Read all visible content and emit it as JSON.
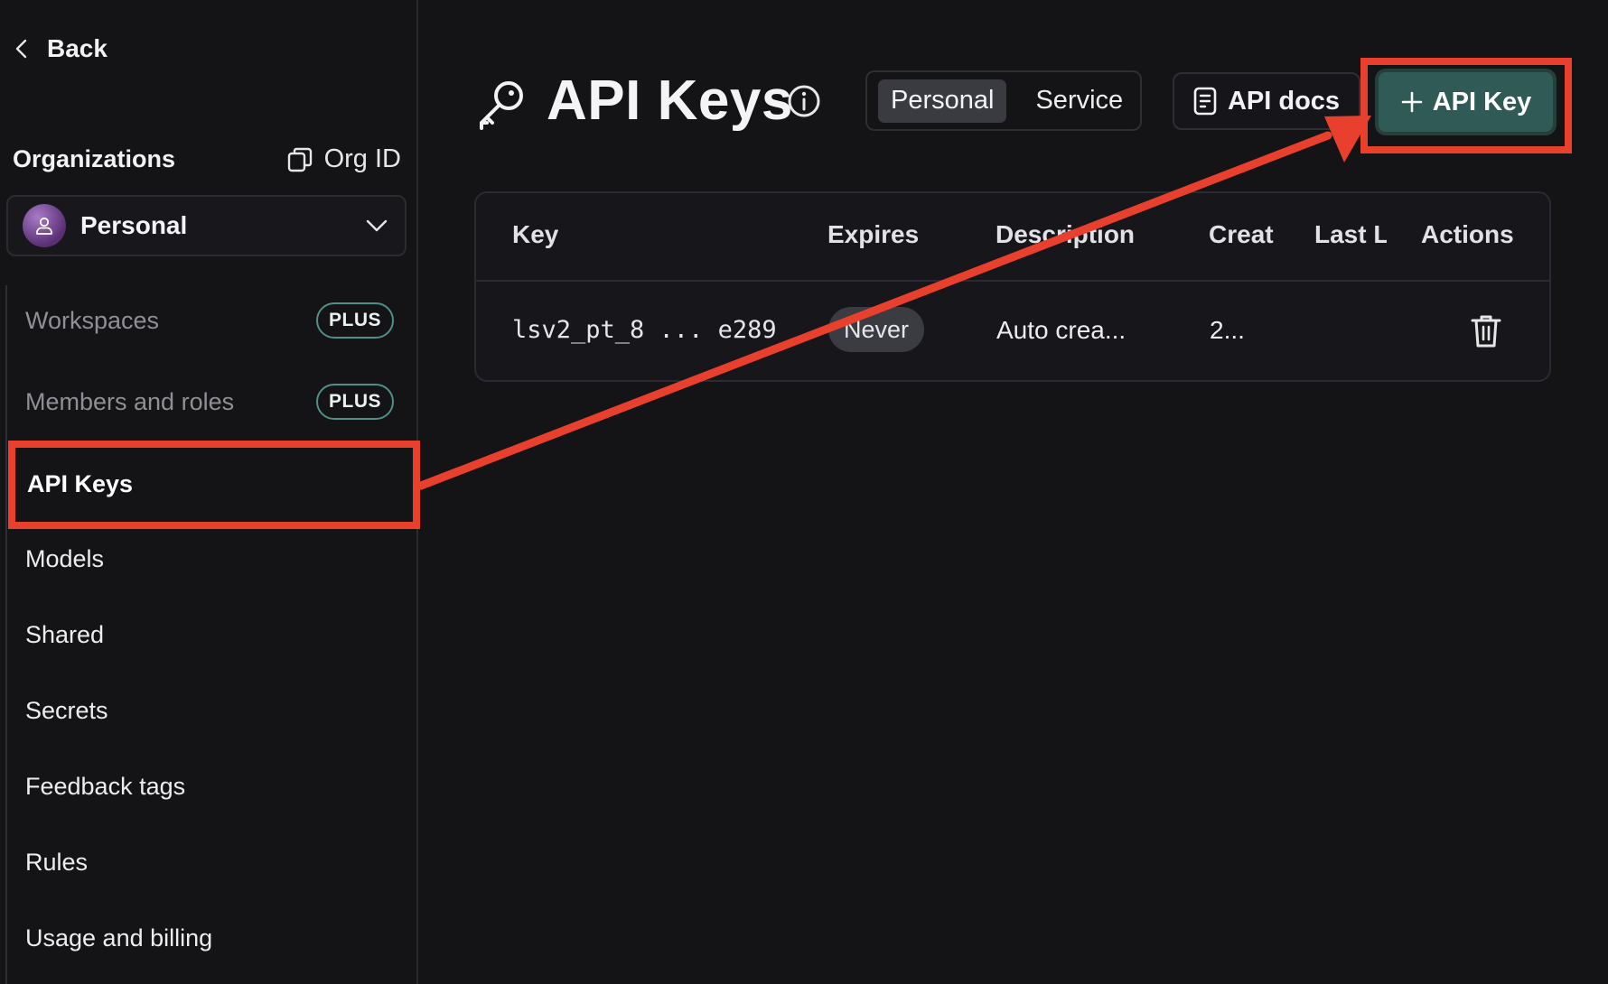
{
  "sidebar": {
    "back_label": "Back",
    "organizations_label": "Organizations",
    "org_id_label": "Org ID",
    "selected_org": "Personal",
    "nav": [
      {
        "label": "Workspaces",
        "badge": "PLUS",
        "muted": true,
        "active": false
      },
      {
        "label": "Members and roles",
        "badge": "PLUS",
        "muted": true,
        "active": false
      },
      {
        "label": "API Keys",
        "active": true
      },
      {
        "label": "Models"
      },
      {
        "label": "Shared"
      },
      {
        "label": "Secrets"
      },
      {
        "label": "Feedback tags"
      },
      {
        "label": "Rules"
      },
      {
        "label": "Usage and billing"
      }
    ]
  },
  "header": {
    "title": "API Keys",
    "tabs": [
      {
        "label": "Personal",
        "selected": true
      },
      {
        "label": "Service",
        "selected": false
      }
    ],
    "docs_button": "API docs",
    "add_button": "API Key"
  },
  "table": {
    "columns": [
      "Key",
      "Expires",
      "Description",
      "Creat",
      "Last L",
      "Actions"
    ],
    "rows": [
      {
        "key": "lsv2_pt_8 ... e289",
        "expires": "Never",
        "description": "Auto crea...",
        "created": "2...",
        "last_used": ""
      }
    ]
  },
  "icons": {
    "title": "key-icon",
    "info": "info-icon",
    "docs": "document-icon",
    "add": "plus-icon",
    "delete": "trash-icon",
    "copy": "copy-icon",
    "back": "chevron-left-icon",
    "dropdown": "chevron-down-icon"
  },
  "colors": {
    "accent_button": "#2f5a56",
    "badge_border": "#4f8f88",
    "annotation": "#e8402d",
    "background": "#141417"
  }
}
